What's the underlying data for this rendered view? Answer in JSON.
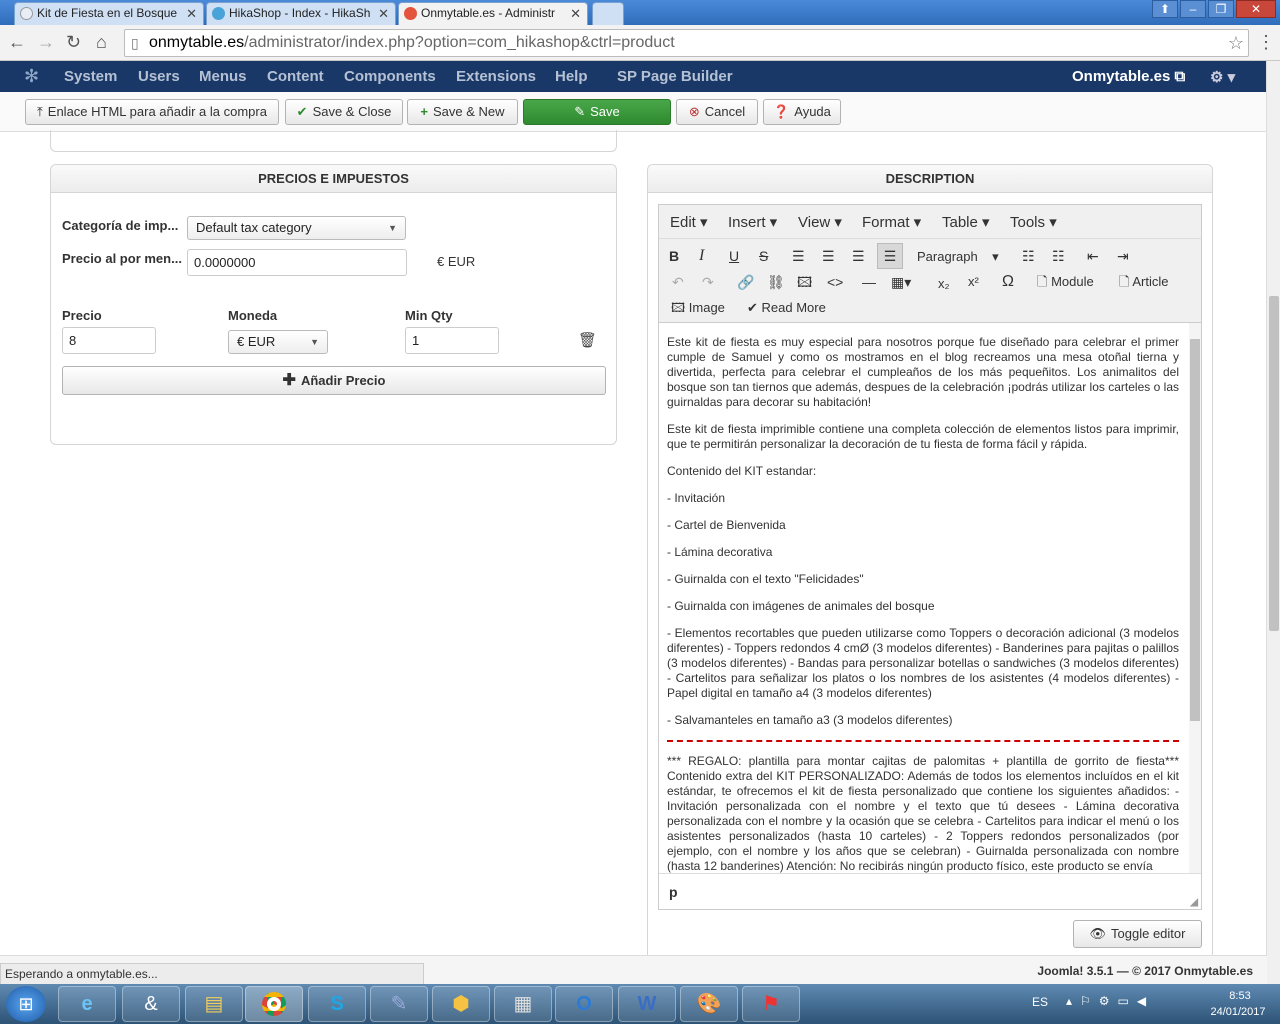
{
  "browser": {
    "tabs": [
      {
        "title": "Kit de Fiesta en el Bosque",
        "active": false
      },
      {
        "title": "HikaShop - Index - HikaSh",
        "active": false
      },
      {
        "title": "Onmytable.es - Administr",
        "active": true
      }
    ],
    "url_host": "onmytable.es",
    "url_path": "/administrator/index.php?option=com_hikashop&ctrl=product"
  },
  "joomla_nav": {
    "items": [
      "System",
      "Users",
      "Menus",
      "Content",
      "Components",
      "Extensions",
      "Help",
      "SP Page Builder"
    ],
    "site": "Onmytable.es"
  },
  "toolbar": {
    "html_link": "Enlace HTML para añadir a la compra",
    "save_close": "Save & Close",
    "save_new": "Save & New",
    "save": "Save",
    "cancel": "Cancel",
    "help": "Ayuda"
  },
  "prices_panel": {
    "title": "PRECIOS E IMPUESTOS",
    "tax_label": "Categoría de imp...",
    "tax_value": "Default tax category",
    "retail_label": "Precio al por men...",
    "retail_value": "0.0000000",
    "retail_currency": "€ EUR",
    "col_price": "Precio",
    "col_currency": "Moneda",
    "col_minqty": "Min Qty",
    "price_value": "8",
    "currency_value": "€ EUR",
    "minqty_value": "1",
    "add_price": "Añadir Precio"
  },
  "description": {
    "title": "DESCRIPTION",
    "menus": [
      "Edit",
      "Insert",
      "View",
      "Format",
      "Table",
      "Tools"
    ],
    "block_format": "Paragraph",
    "module_btn": "Module",
    "article_btn": "Article",
    "image_btn": "Image",
    "readmore_btn": "Read More",
    "paragraphs": [
      "Este kit de fiesta es muy especial para nosotros porque fue diseñado para celebrar el primer cumple de Samuel y como os mostramos en el blog recreamos una mesa otoñal tierna y divertida, perfecta para celebrar el cumpleaños de los más pequeñitos.  Los animalitos del bosque son tan tiernos que además, despues de la celebración ¡podrás utilizar los carteles o las guirnaldas para decorar su habitación!",
      "Este kit de fiesta imprimible contiene una completa colección de elementos listos para imprimir, que te permitirán personalizar la decoración de tu fiesta de forma fácil y rápida.",
      "Contenido del KIT estandar:",
      "- Invitación",
      "- Cartel de Bienvenida",
      "- Lámina decorativa",
      "- Guirnalda con el texto \"Felicidades\"",
      "- Guirnalda con imágenes de animales del bosque",
      "- Elementos recortables que pueden utilizarse como Toppers o decoración adicional (3 modelos diferentes) - Toppers redondos 4 cmØ (3 modelos diferentes) - Banderines para pajitas o palillos (3 modelos diferentes) - Bandas para personalizar botellas o sandwiches (3 modelos diferentes) - Cartelitos para señalizar los platos o los nombres de los asistentes (4 modelos diferentes) - Papel digital en tamaño a4 (3 modelos diferentes)",
      "- Salvamanteles en tamaño a3 (3 modelos diferentes)"
    ],
    "after_readmore": "*** REGALO: plantilla para montar cajitas de palomitas + plantilla de gorrito de fiesta*** Contenido extra del KIT PERSONALIZADO: Además de todos los elementos incluídos en el kit estándar, te ofrecemos el kit de fiesta personalizado que contiene los siguientes añadidos: - Invitación personalizada con el nombre y el texto que tú desees - Lámina decorativa personalizada con el nombre y la ocasión que se celebra - Cartelitos para indicar el menú o los asistentes personalizados (hasta 10 carteles) - 2 Toppers redondos personalizados (por ejemplo, con el nombre y los años que se celebran) - Guirnalda personalizada con nombre (hasta 12 banderines) Atención: No recibirás ningún producto físico, este producto se envía",
    "path": "p",
    "toggle": "Toggle editor"
  },
  "status": {
    "loading": "Esperando a onmytable.es...",
    "footer": "Joomla! 3.5.1  —  © 2017 Onmytable.es"
  },
  "taskbar": {
    "lang": "ES",
    "time": "8:53",
    "date": "24/01/2017"
  }
}
